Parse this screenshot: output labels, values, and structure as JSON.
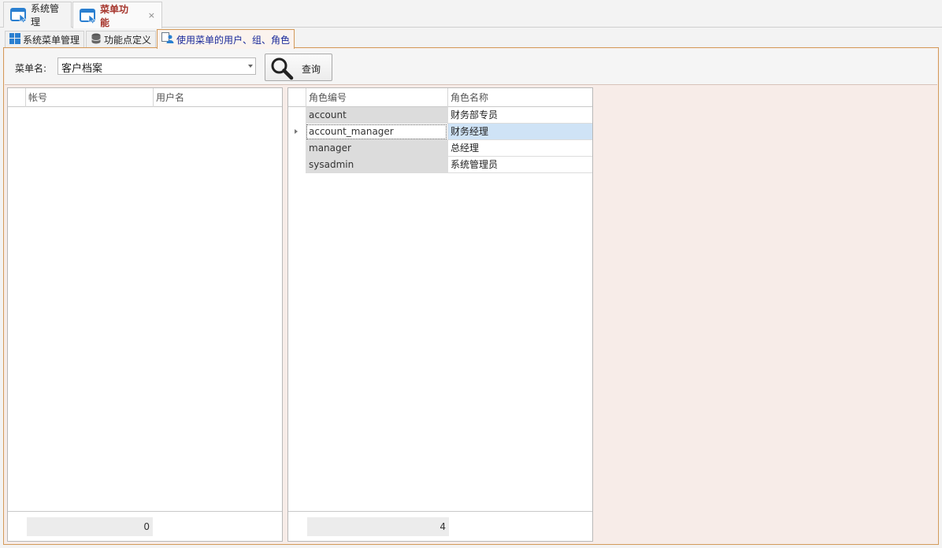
{
  "doc_tabs": [
    {
      "label": "系统管理",
      "active": false
    },
    {
      "label": "菜单功能",
      "active": true,
      "close_glyph": "×"
    }
  ],
  "page_tabs": [
    {
      "label": "系统菜单管理",
      "icon": "windows-grid-icon"
    },
    {
      "label": "功能点定义",
      "icon": "database-icon"
    },
    {
      "label": "使用菜单的用户、组、角色",
      "icon": "user-group-icon",
      "active": true
    }
  ],
  "toolbar": {
    "menu_label": "菜单名:",
    "menu_value": "客户档案",
    "query_label": "查询"
  },
  "user_grid": {
    "columns": [
      "帐号",
      "用户名"
    ],
    "rows": [],
    "footer_count": "0"
  },
  "role_grid": {
    "columns": [
      "角色编号",
      "角色名称"
    ],
    "rows": [
      {
        "code": "account",
        "name": "财务部专员"
      },
      {
        "code": "account_manager",
        "name": "财务经理",
        "focused": true
      },
      {
        "code": "manager",
        "name": "总经理"
      },
      {
        "code": "sysadmin",
        "name": "系统管理员"
      }
    ],
    "footer_count": "4"
  },
  "colors": {
    "active_doc_tab_text": "#a5332a",
    "active_page_tab_text": "#1a2a9a",
    "frame_border": "#d39a5a",
    "selection": "#cfe3f6"
  }
}
